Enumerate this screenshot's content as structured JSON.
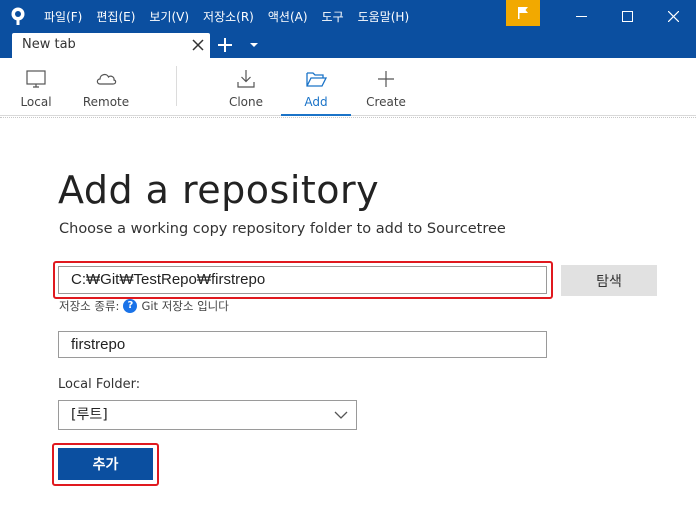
{
  "menu": {
    "items": [
      "파일(F)",
      "편집(E)",
      "보기(V)",
      "저장소(R)",
      "액션(A)",
      "도구",
      "도움말(H)"
    ]
  },
  "tabs": {
    "active_label": "New tab"
  },
  "toolbar": {
    "local": "Local",
    "remote": "Remote",
    "clone": "Clone",
    "add": "Add",
    "create": "Create"
  },
  "page": {
    "title": "Add a repository",
    "subtitle": "Choose a working copy repository folder to add to Sourcetree"
  },
  "form": {
    "path_value": "C:₩Git₩TestRepo₩firstrepo",
    "browse_label": "탐색",
    "repo_type_label": "저장소 종류:",
    "repo_type_help": "?",
    "repo_type_value": "Git 저장소 입니다",
    "name_value": "firstrepo",
    "local_folder_label": "Local Folder:",
    "local_folder_value": "[루트]",
    "add_button_label": "추가"
  },
  "colors": {
    "brand": "#0b4fa0",
    "accent": "#1a73c8",
    "highlight": "#e0191f",
    "flag": "#f2a900"
  },
  "icons": {
    "logo": "sourcetree-logo-icon",
    "flag": "flag-icon",
    "local": "monitor-icon",
    "remote": "cloud-icon",
    "clone": "download-icon",
    "add": "folder-open-icon",
    "create": "plus-icon"
  }
}
